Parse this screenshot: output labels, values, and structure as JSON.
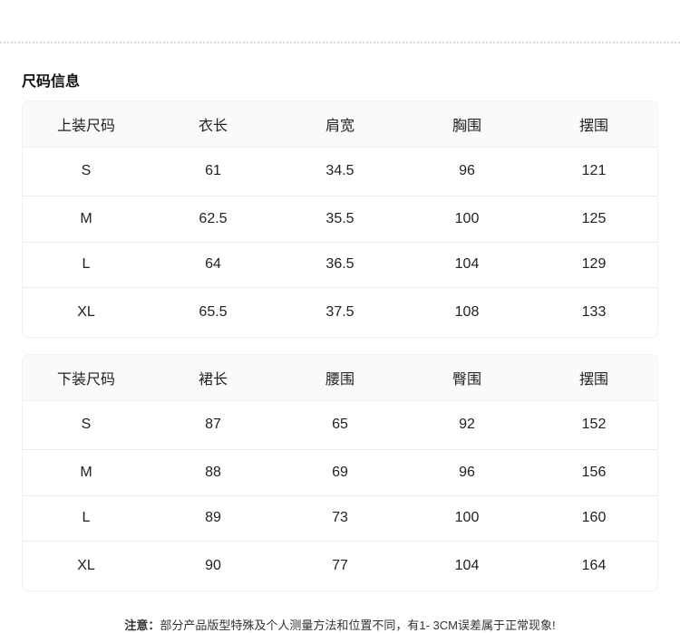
{
  "section_title": "尺码信息",
  "tops": {
    "headers": [
      "上装尺码",
      "衣长",
      "肩宽",
      "胸围",
      "摆围"
    ],
    "rows": [
      [
        "S",
        "61",
        "34.5",
        "96",
        "121"
      ],
      [
        "M",
        "62.5",
        "35.5",
        "100",
        "125"
      ],
      [
        "L",
        "64",
        "36.5",
        "104",
        "129"
      ],
      [
        "XL",
        "65.5",
        "37.5",
        "108",
        "133"
      ]
    ]
  },
  "bottoms": {
    "headers": [
      "下装尺码",
      "裙长",
      "腰围",
      "臀围",
      "摆围"
    ],
    "rows": [
      [
        "S",
        "87",
        "65",
        "92",
        "152"
      ],
      [
        "M",
        "88",
        "69",
        "96",
        "156"
      ],
      [
        "L",
        "89",
        "73",
        "100",
        "160"
      ],
      [
        "XL",
        "90",
        "77",
        "104",
        "164"
      ]
    ]
  },
  "note": {
    "label": "注意：",
    "text": "部分产品版型特殊及个人测量方法和位置不同，有1- 3CM误差属于正常现象!"
  }
}
